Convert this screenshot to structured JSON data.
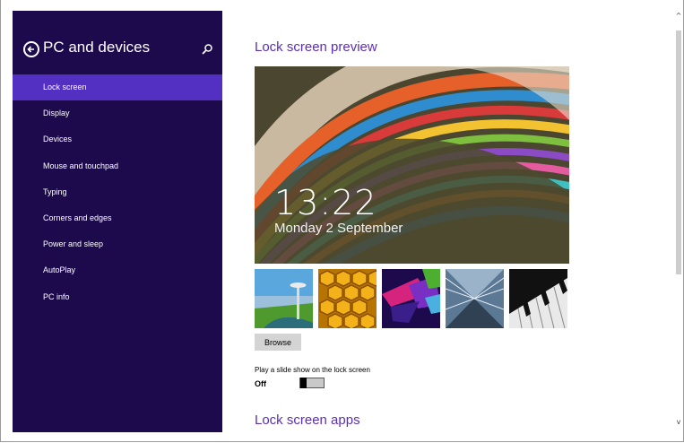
{
  "sidebar": {
    "title": "PC and devices",
    "back_icon": "back-arrow-icon",
    "search_icon": "search-icon",
    "items": [
      {
        "label": "Lock screen",
        "active": true
      },
      {
        "label": "Display"
      },
      {
        "label": "Devices"
      },
      {
        "label": "Mouse and touchpad"
      },
      {
        "label": "Typing"
      },
      {
        "label": "Corners and edges"
      },
      {
        "label": "Power and sleep"
      },
      {
        "label": "AutoPlay"
      },
      {
        "label": "PC info"
      }
    ],
    "colors": {
      "background": "#1c0a4c",
      "active": "#5330c1"
    }
  },
  "main": {
    "preview_heading": "Lock screen preview",
    "preview": {
      "time": "13:22",
      "date": "Monday 2 September"
    },
    "thumbnails": [
      "space-needle-thumbnail",
      "honeycomb-thumbnail",
      "abstract-shapes-thumbnail",
      "building-interior-thumbnail",
      "piano-keys-thumbnail"
    ],
    "browse_label": "Browse",
    "slideshow_label": "Play a slide show on the lock screen",
    "slideshow_state": "Off",
    "slideshow_on": false,
    "apps_heading": "Lock screen apps",
    "accent_color": "#5b2fb8"
  },
  "scrollbar": {
    "up_glyph": "^",
    "down_glyph": "v"
  }
}
